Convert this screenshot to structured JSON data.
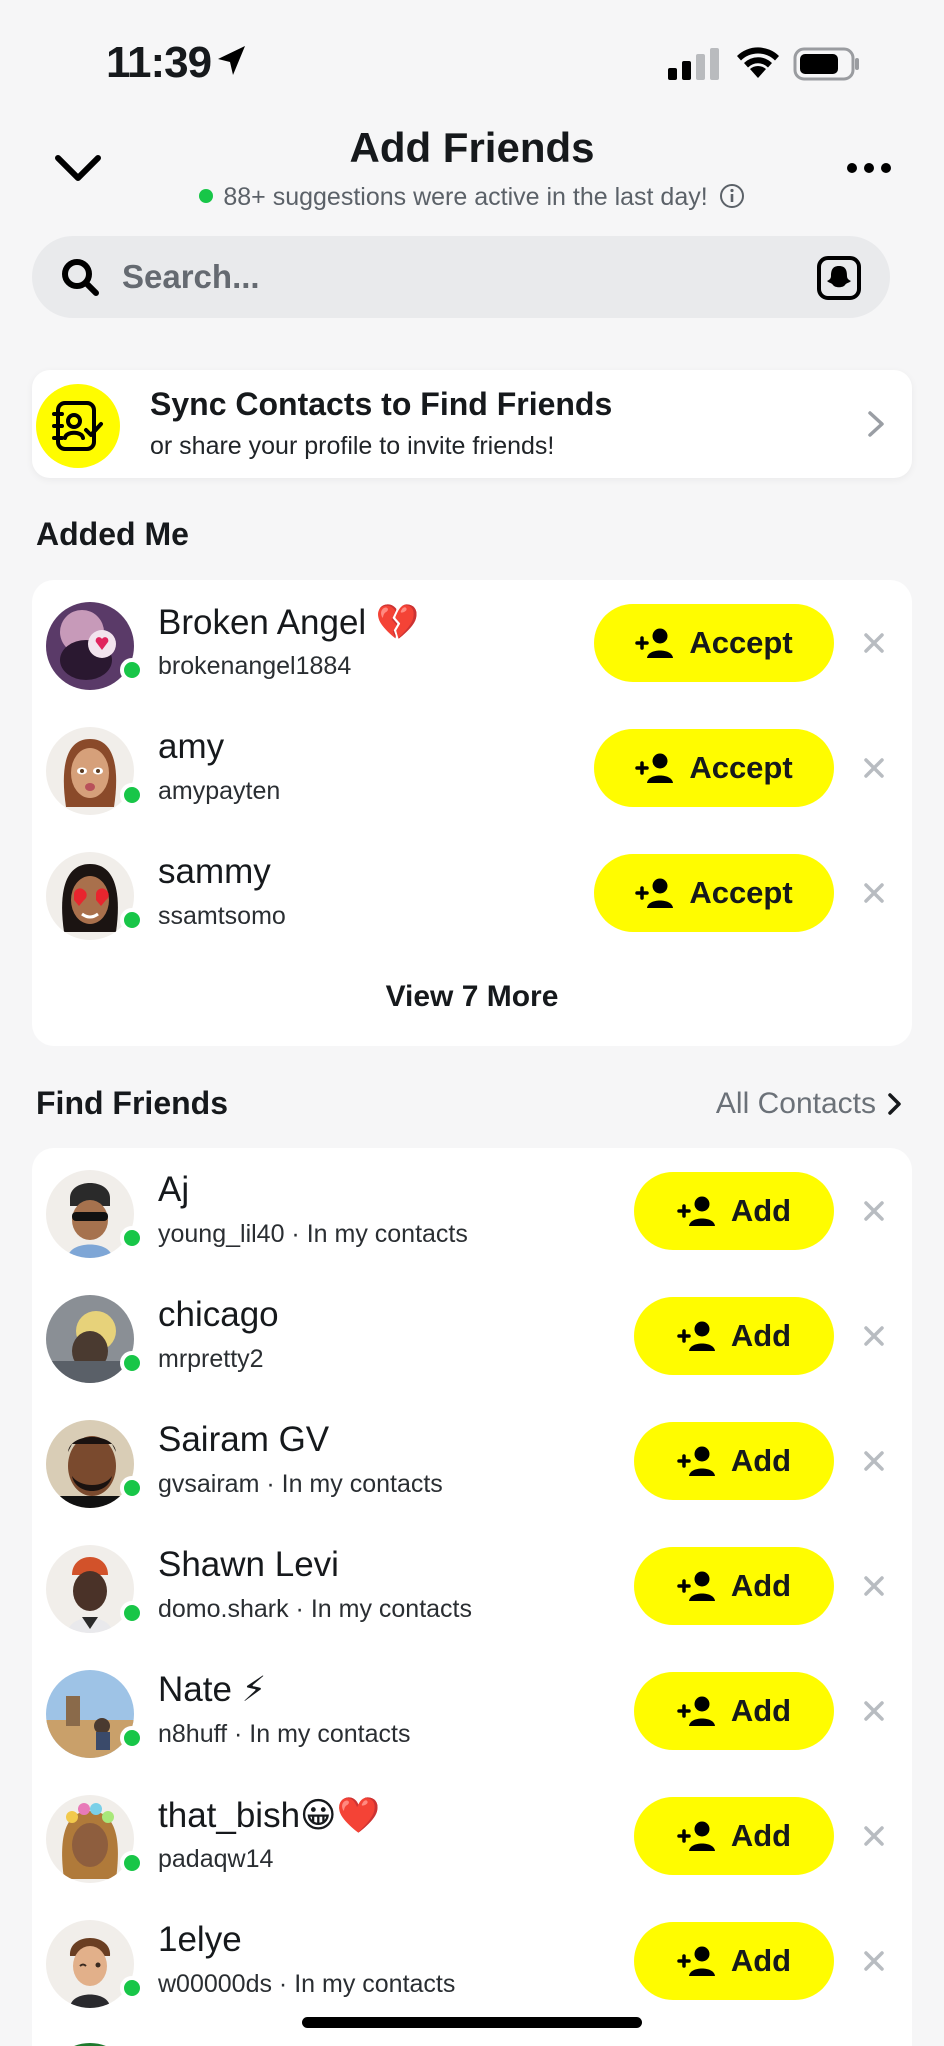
{
  "status_bar": {
    "time": "11:39"
  },
  "header": {
    "title": "Add Friends",
    "subtitle": "88+ suggestions were active in the last day!"
  },
  "search": {
    "placeholder": "Search..."
  },
  "sync_card": {
    "title": "Sync Contacts to Find Friends",
    "subtitle": "or share your profile to invite friends!"
  },
  "added_me": {
    "header": "Added Me",
    "action_label": "Accept",
    "items": [
      {
        "name": "Broken Angel 💔",
        "username": "brokenangel1884"
      },
      {
        "name": "amy",
        "username": "amypayten"
      },
      {
        "name": "sammy",
        "username": "ssamtsomo"
      }
    ],
    "view_more": "View 7 More"
  },
  "find_friends": {
    "header": "Find Friends",
    "all_contacts": "All Contacts",
    "action_label": "Add",
    "items": [
      {
        "name": "Aj",
        "username": "young_lil40 · In my contacts"
      },
      {
        "name": "chicago",
        "username": "mrpretty2"
      },
      {
        "name": "Sairam GV",
        "username": "gvsairam · In my contacts"
      },
      {
        "name": "Shawn Levi",
        "username": "domo.shark · In my contacts"
      },
      {
        "name": "Nate ⚡",
        "username": "n8huff · In my contacts"
      },
      {
        "name": "that_bish😀❤️",
        "username": "padaqw14"
      },
      {
        "name": "1elye",
        "username": "w00000ds · In my contacts"
      }
    ]
  },
  "colors": {
    "accent": "#fffc00",
    "online": "#18c648",
    "background": "#f6f6f7"
  }
}
